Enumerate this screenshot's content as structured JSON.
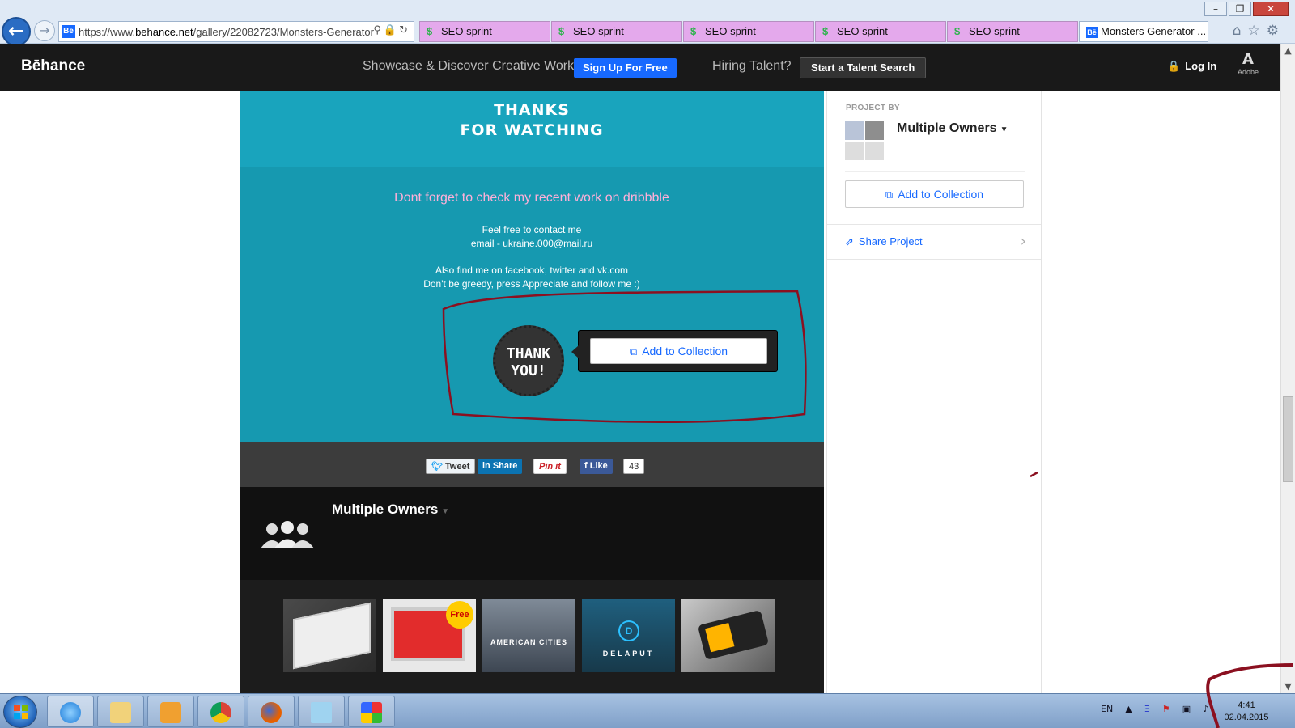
{
  "browser": {
    "url_prefix": "https://www.",
    "url_host": "behance.net",
    "url_path": "/gallery/22082723/Monsters-Generator",
    "favicon": "Bē",
    "tabs": [
      {
        "label": "SEO sprint",
        "icon": "seosprint-icon"
      },
      {
        "label": "SEO sprint",
        "icon": "seosprint-icon"
      },
      {
        "label": "SEO sprint",
        "icon": "seosprint-icon"
      },
      {
        "label": "SEO sprint",
        "icon": "seosprint-icon"
      },
      {
        "label": "SEO sprint",
        "icon": "seosprint-icon"
      },
      {
        "label": "Monsters Generator ...",
        "icon": "behance-icon"
      }
    ]
  },
  "header": {
    "logo": "Bēhance",
    "tagline": "Showcase & Discover Creative Work",
    "signup": "Sign Up For Free",
    "hiring": "Hiring Talent?",
    "talent_search": "Start a Talent Search",
    "login": "Log In",
    "adobe": "Adobe"
  },
  "project": {
    "thanks_line1": "THANKS",
    "thanks_line2": "FOR WATCHING",
    "dribbble": "Dont forget to check my recent work on dribbble",
    "contact_line1": "Feel free to contact me",
    "contact_line2": "email - ukraine.000@mail.ru",
    "find_line1": "Also find me on facebook, twitter and vk.com",
    "find_line2": "Don't be greedy, press Appreciate and follow me :)",
    "seal_line1": "THANK",
    "seal_line2": "YOU!",
    "add_to_collection": "Add to Collection",
    "share": {
      "tweet": "Tweet",
      "linkedin": "Share",
      "pinterest": "Pin it",
      "like": "Like",
      "like_count": "43"
    },
    "owner_name": "Multiple Owners",
    "thumbnails": [
      {
        "label": ""
      },
      {
        "label": "Free"
      },
      {
        "label": "AMERICAN CITIES"
      },
      {
        "label": "DELAPUT"
      },
      {
        "label": ""
      }
    ]
  },
  "sidebar": {
    "project_by": "PROJECT BY",
    "owner_name": "Multiple Owners",
    "add_to_collection": "Add to Collection",
    "share_project": "Share Project"
  },
  "taskbar": {
    "lang": "EN",
    "time": "4:41",
    "date": "02.04.2015"
  },
  "colors": {
    "behance_blue": "#1769ff",
    "project_teal": "#1aa0b8",
    "annotation_red": "#8b1020"
  }
}
